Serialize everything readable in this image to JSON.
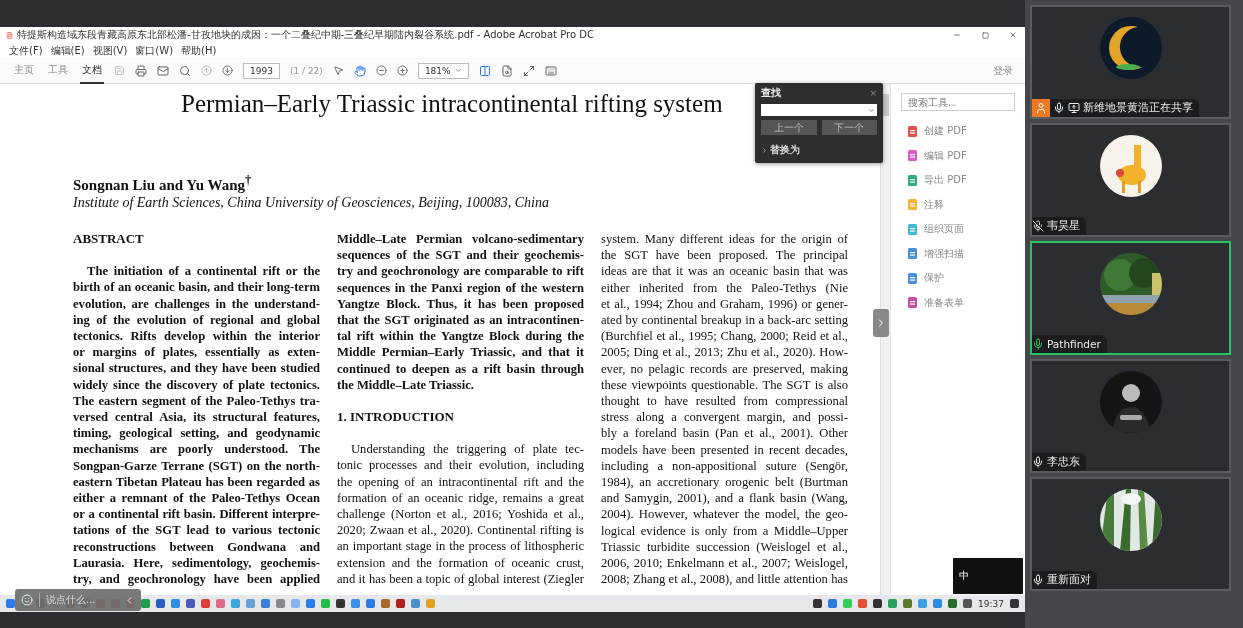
{
  "window": {
    "title": "特提斯构造域东段青藏高原东北部松潘-甘孜地块的成因：一个二叠纪中期-三叠纪早期陆内裂谷系统.pdf - Adobe Acrobat Pro DC"
  },
  "menu": [
    "文件(F)",
    "编辑(E)",
    "视图(V)",
    "窗口(W)",
    "帮助(H)"
  ],
  "tabs": [
    {
      "label": "主页",
      "selected": false
    },
    {
      "label": "工具",
      "selected": false
    },
    {
      "label": "文档",
      "selected": true
    }
  ],
  "toolbar": {
    "page": "1993",
    "page_count": "(1 / 22)",
    "zoom": "181%",
    "sign_in": "登录"
  },
  "document": {
    "title": "Permian–Early Triassic intracontinental rifting system",
    "authors": "Songnan Liu and Yu Wang$^{†}$",
    "affiliation": "Institute of Earth Sciences, China University of Geosciences, Beijing, 100083, China",
    "columns": [
      [
        {
          "kind": "heading",
          "text": "ABSTRACT"
        },
        {
          "kind": "paragraph",
          "bold": true,
          "indent": true,
          "ends": false,
          "lines": [
            "The initiation of a continental rift or the",
            "birth of an oceanic basin, and their long-term",
            "evolution, are challenges in the understand-",
            "ing of the evolution of regional and global",
            "tectonics. Rifts develop within the interior",
            "or margins of plates, essentially as exten-",
            "sional structures, and they have been studied",
            "widely since the discovery of plate tectonics.",
            "The eastern segment of the Paleo-Tethys tra-",
            "versed central Asia, its structural features,",
            "timing, geological setting, and geodynamic",
            "mechanisms are poorly understood. The",
            "Songpan-Garze Terrane (SGT) on the north-",
            "eastern Tibetan Plateau has been regarded as",
            "either a remnant of the Paleo-Tethys Ocean",
            "or a continental rift basin. Different interpre-",
            "tations of the SGT lead to various tectonic",
            "reconstructions between Gondwana and",
            "Laurasia. Here, sedimentology, geochemis-",
            "try, and geochronology have been applied"
          ]
        }
      ],
      [
        {
          "kind": "paragraph",
          "bold": true,
          "indent": false,
          "ends": true,
          "lines": [
            "Middle–Late Permian volcano-sedimentary",
            "sequences of the SGT and their geochemis-",
            "try and geochronology are comparable to rift",
            "sequences in the Panxi region of the western",
            "Yangtze Block. Thus, it has been proposed",
            "that the SGT originated as an intracontinen-",
            "tal rift within the Yangtze Block during the",
            "Middle Permian–Early Triassic, and that it",
            "continued to deepen as a rift basin through",
            "the Middle–Late Triassic."
          ]
        },
        {
          "kind": "heading",
          "text": "1. INTRODUCTION"
        },
        {
          "kind": "paragraph",
          "bold": false,
          "indent": true,
          "ends": false,
          "lines": [
            "Understanding the triggering of plate tec-",
            "tonic processes and their evolution, including",
            "the opening of an intracontinental rift and the",
            "formation of an oceanic ridge, remains a great",
            "challenge (Norton et al., 2016; Yoshida et al.,",
            "2020; Zwaan et al., 2020). Continental rifting is",
            "an important stage in the process of lithospheric",
            "extension and the formation of oceanic crust,",
            "and it has been a topic of global interest (Ziegler"
          ]
        }
      ],
      [
        {
          "kind": "paragraph",
          "bold": false,
          "indent": false,
          "ends": false,
          "lines": [
            "system. Many different ideas for the origin of",
            "the SGT have been proposed. The principal",
            "ideas are that it was an oceanic basin that was",
            "either inherited from the Paleo-Tethys (Nie",
            "et al., 1994; Zhou and Graham, 1996) or gener-",
            "ated by continental breakup in a back-arc setting",
            "(Burchfiel et al., 1995; Chang, 2000; Reid et al.,",
            "2005; Ding et al., 2013; Zhu et al., 2020). How-",
            "ever, no pelagic records are preserved, making",
            "these viewpoints questionable. The SGT is also",
            "thought to have resulted from compressional",
            "stress along a convergent margin, and possi-",
            "bly a foreland basin (Pan et al., 2001). Other",
            "models have been presented in recent decades,",
            "including a non-appositional suture (Sengör,",
            "1984), an accretionary orogenic belt (Burtman",
            "and Samygin, 2001), and a flank basin (Wang,",
            "2004). However, whatever the model, the geo-",
            "logical evidence is only from a Middle–Upper",
            "Triassic turbidite succession (Weislogel et al.,",
            "2006, 2010; Enkelmann et al., 2007; Weislogel,",
            "2008; Zhang et al., 2008), and little attention has"
          ]
        }
      ]
    ]
  },
  "find_panel": {
    "title": "查找",
    "close": "×",
    "buttons": [
      "上一个",
      "下一个"
    ],
    "replace": {
      "label": "替换为",
      "expanded": false
    }
  },
  "tools_pane": {
    "search": {
      "placeholder": "搜索工具..."
    },
    "items": [
      {
        "label": "创建 PDF",
        "color": "#e0514a"
      },
      {
        "label": "编辑 PDF",
        "color": "#d65cc8"
      },
      {
        "label": "导出 PDF",
        "color": "#2fae7a"
      },
      {
        "label": "注释",
        "color": "#f2b634"
      },
      {
        "label": "组织页面",
        "color": "#3fb8d6"
      },
      {
        "label": "增强扫描",
        "color": "#4a8fe0"
      },
      {
        "label": "保护",
        "color": "#4a8fe0"
      },
      {
        "label": "准备表单",
        "color": "#c24fa8"
      }
    ]
  },
  "chat_bar": {
    "placeholder": "说点什么..."
  },
  "ime": {
    "mode": "中"
  },
  "taskbar": {
    "time": "19:37"
  },
  "participants": [
    {
      "name": "新维地景黄浩正在共享",
      "presenter": true,
      "sharing": true,
      "muted": false,
      "active": false
    },
    {
      "name": "韦昊星",
      "presenter": false,
      "sharing": false,
      "muted": true,
      "active": false
    },
    {
      "name": "Pathfinder",
      "presenter": false,
      "sharing": false,
      "muted": false,
      "active": true
    },
    {
      "name": "李忠东",
      "presenter": false,
      "sharing": false,
      "muted": false,
      "active": false
    },
    {
      "name": "重新面对",
      "presenter": false,
      "sharing": false,
      "muted": false,
      "active": false
    }
  ]
}
